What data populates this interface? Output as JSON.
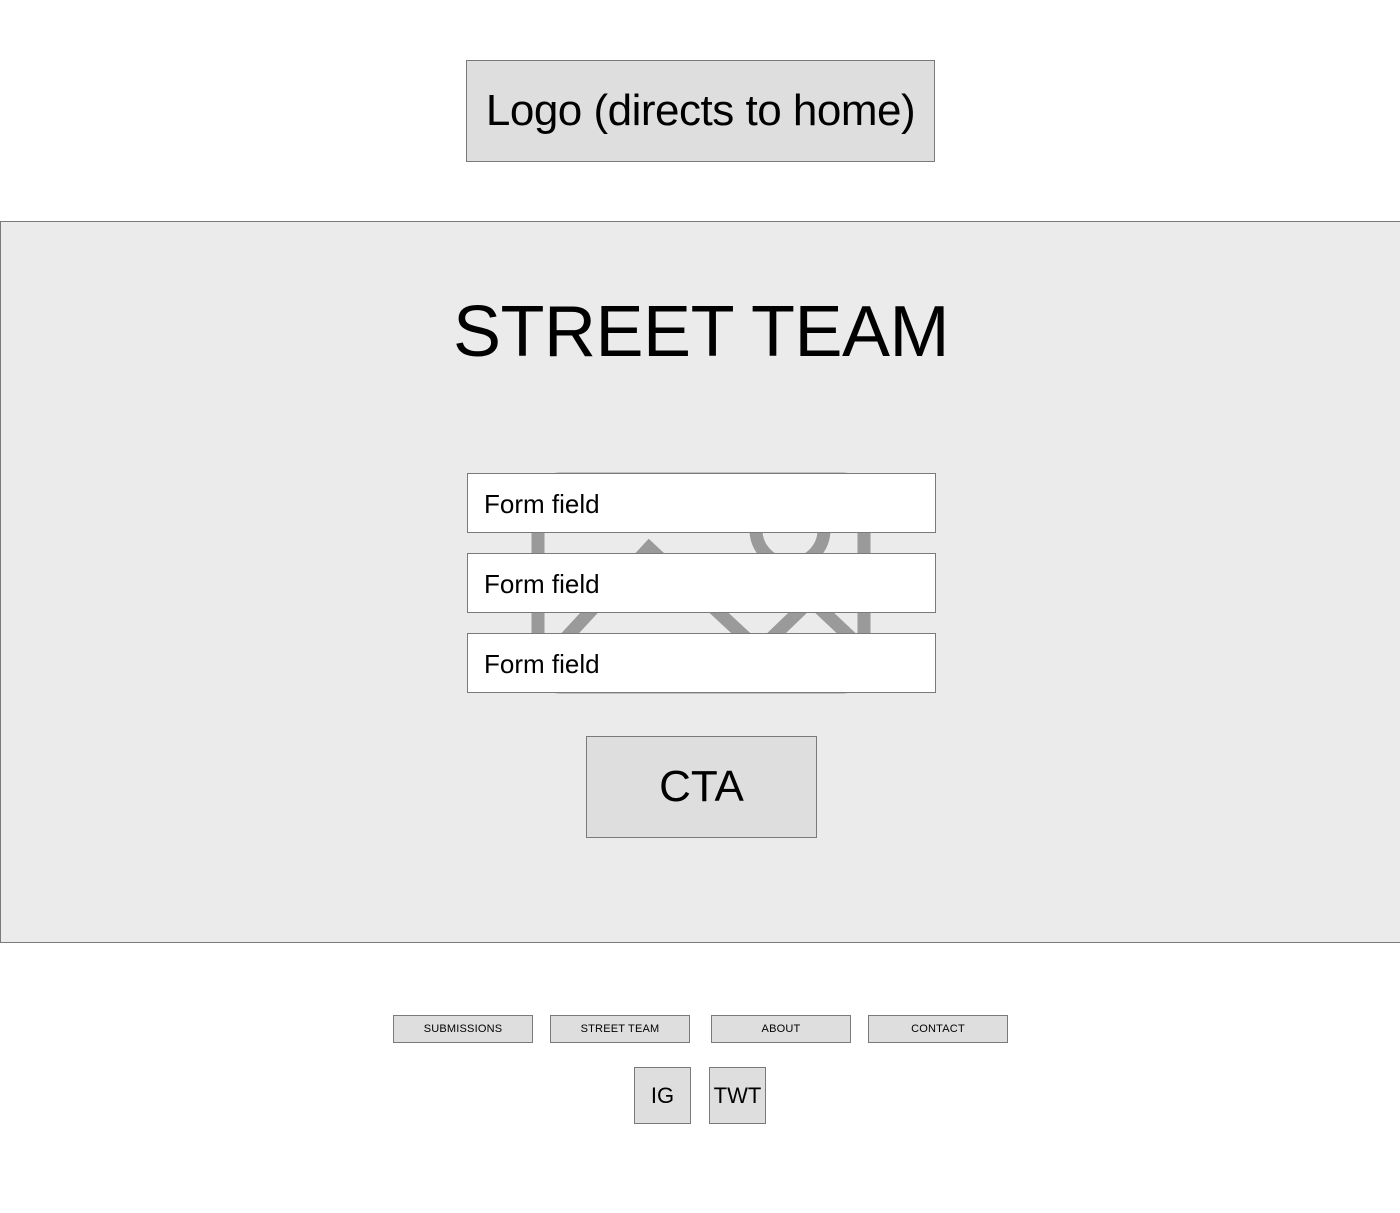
{
  "header": {
    "logo_label": "Logo (directs to home)"
  },
  "hero": {
    "title": "STREET TEAM",
    "background_image_icon": "image-placeholder-icon",
    "form_fields": [
      {
        "placeholder": "Form field"
      },
      {
        "placeholder": "Form field"
      },
      {
        "placeholder": "Form field"
      }
    ],
    "cta_label": "CTA"
  },
  "footer": {
    "nav": [
      {
        "label": "SUBMISSIONS"
      },
      {
        "label": "STREET TEAM"
      },
      {
        "label": "ABOUT"
      },
      {
        "label": "CONTACT"
      }
    ],
    "social": [
      {
        "label": "IG"
      },
      {
        "label": "TWT"
      }
    ]
  },
  "colors": {
    "page_background": "#ffffff",
    "hero_background": "#ebebeb",
    "box_background": "#dedede",
    "border": "#7a7a7a",
    "placeholder_graphic": "#9a9a9a"
  }
}
